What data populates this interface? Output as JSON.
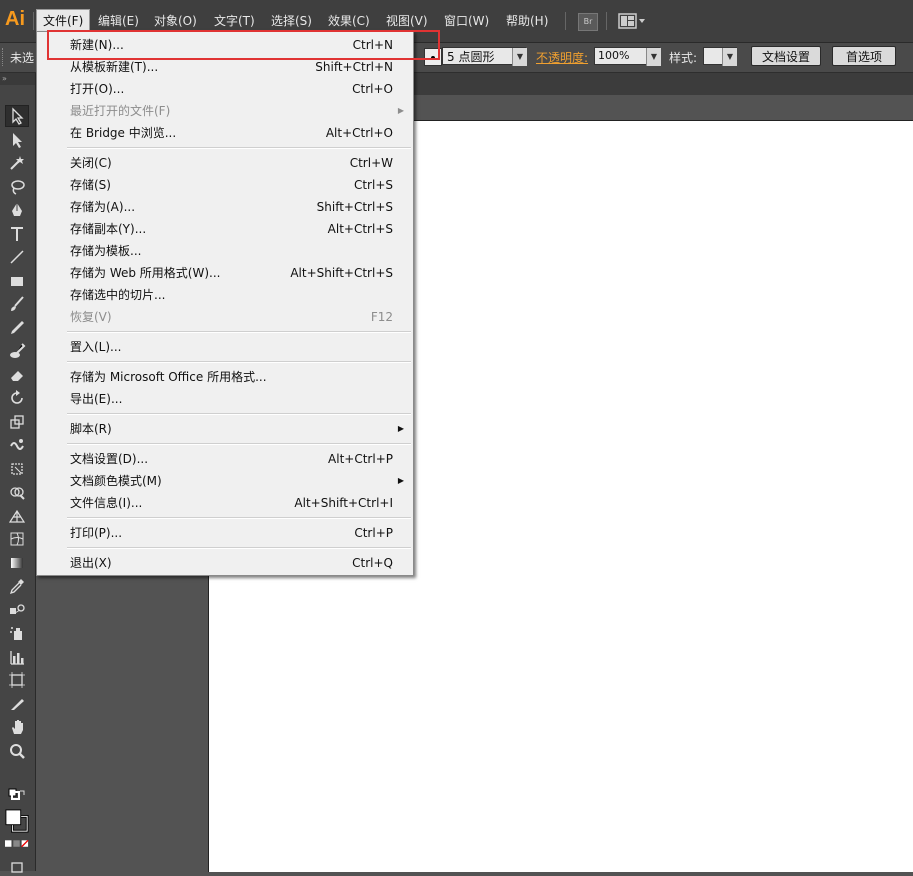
{
  "app": {
    "logo": "Ai"
  },
  "menubar": {
    "items": [
      "文件(F)",
      "编辑(E)",
      "对象(O)",
      "文字(T)",
      "选择(S)",
      "效果(C)",
      "视图(V)",
      "窗口(W)",
      "帮助(H)"
    ],
    "bridge_label": "Br"
  },
  "controlbar": {
    "selection_status": "未选",
    "brush_value": "5 点圆形",
    "opacity_label": "不透明度:",
    "opacity_value": "100%",
    "style_label": "样式:",
    "doc_settings_button": "文档设置",
    "preferences_button": "首选项"
  },
  "file_menu": {
    "groups": [
      [
        {
          "label": "新建(N)...",
          "shortcut": "Ctrl+N"
        },
        {
          "label": "从模板新建(T)...",
          "shortcut": "Shift+Ctrl+N"
        },
        {
          "label": "打开(O)...",
          "shortcut": "Ctrl+O"
        },
        {
          "label": "最近打开的文件(F)",
          "shortcut": "",
          "submenu": true,
          "disabled": true
        },
        {
          "label": "在 Bridge 中浏览...",
          "shortcut": "Alt+Ctrl+O"
        }
      ],
      [
        {
          "label": "关闭(C)",
          "shortcut": "Ctrl+W"
        },
        {
          "label": "存储(S)",
          "shortcut": "Ctrl+S"
        },
        {
          "label": "存储为(A)...",
          "shortcut": "Shift+Ctrl+S"
        },
        {
          "label": "存储副本(Y)...",
          "shortcut": "Alt+Ctrl+S"
        },
        {
          "label": "存储为模板...",
          "shortcut": ""
        },
        {
          "label": "存储为 Web 所用格式(W)...",
          "shortcut": "Alt+Shift+Ctrl+S"
        },
        {
          "label": "存储选中的切片...",
          "shortcut": ""
        },
        {
          "label": "恢复(V)",
          "shortcut": "F12",
          "disabled": true
        }
      ],
      [
        {
          "label": "置入(L)...",
          "shortcut": ""
        }
      ],
      [
        {
          "label": "存储为 Microsoft Office 所用格式...",
          "shortcut": ""
        },
        {
          "label": "导出(E)...",
          "shortcut": ""
        }
      ],
      [
        {
          "label": "脚本(R)",
          "shortcut": "",
          "submenu": true
        }
      ],
      [
        {
          "label": "文档设置(D)...",
          "shortcut": "Alt+Ctrl+P"
        },
        {
          "label": "文档颜色模式(M)",
          "shortcut": "",
          "submenu": true
        },
        {
          "label": "文件信息(I)...",
          "shortcut": "Alt+Shift+Ctrl+I"
        }
      ],
      [
        {
          "label": "打印(P)...",
          "shortcut": "Ctrl+P"
        }
      ],
      [
        {
          "label": "退出(X)",
          "shortcut": "Ctrl+Q"
        }
      ]
    ]
  },
  "tools": [
    "selection-tool",
    "direct-selection-tool",
    "magic-wand-tool",
    "lasso-tool",
    "pen-tool",
    "type-tool",
    "line-segment-tool",
    "rectangle-tool",
    "paintbrush-tool",
    "pencil-tool",
    "blob-brush-tool",
    "eraser-tool",
    "rotate-tool",
    "scale-tool",
    "warp-tool",
    "free-transform-tool",
    "shape-builder-tool",
    "perspective-grid-tool",
    "mesh-tool",
    "gradient-tool",
    "eyedropper-tool",
    "blend-tool",
    "symbol-sprayer-tool",
    "column-graph-tool",
    "artboard-tool",
    "slice-tool",
    "hand-tool",
    "zoom-tool"
  ]
}
